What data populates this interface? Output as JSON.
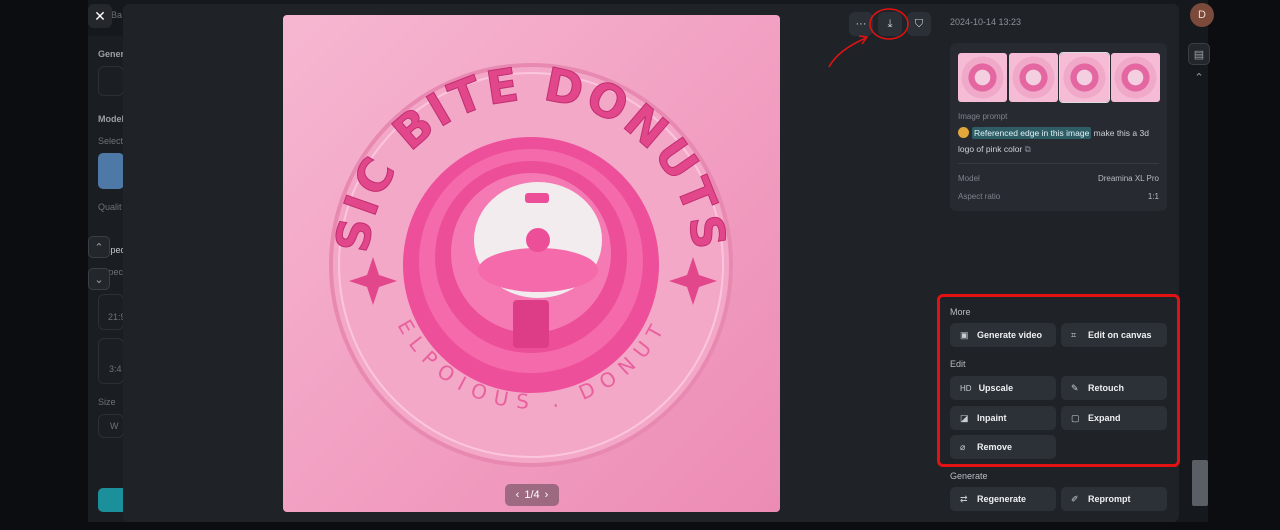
{
  "background": {
    "back_label": "Ba",
    "labels": [
      "Gener",
      "Model",
      "Select",
      "Qualit",
      "Aspec",
      "Aspec",
      "21:9",
      "3:4",
      "Size",
      "W"
    ],
    "avatar_letter": "D"
  },
  "toolbar": {
    "close_glyph": "✕",
    "more_glyph": "···",
    "download_glyph": "⤓",
    "bookmark_glyph": "⛉"
  },
  "image": {
    "top_text": "SIC BITE DONUTS",
    "bottom_text": "DELPOIOUS . DONUTS",
    "pager": "1/4",
    "prev_glyph": "‹",
    "next_glyph": "›"
  },
  "info": {
    "timestamp": "2024-10-14 13:23",
    "image_prompt_label": "Image prompt",
    "reference_chip": "Referenced edge in this image",
    "prompt_text": "make this a 3d logo of pink color",
    "copy_glyph": "⧉",
    "model_label": "Model",
    "model_value": "Dreamina XL Pro",
    "aspect_label": "Aspect ratio",
    "aspect_value": "1:1"
  },
  "actions": {
    "more_label": "More",
    "generate_video": "Generate video",
    "edit_on_canvas": "Edit on canvas",
    "edit_label": "Edit",
    "upscale": "Upscale",
    "retouch": "Retouch",
    "inpaint": "Inpaint",
    "expand": "Expand",
    "remove": "Remove",
    "generate_label": "Generate",
    "regenerate": "Regenerate",
    "reprompt": "Reprompt",
    "icons": {
      "generate_video": "▣",
      "edit_on_canvas": "⌗",
      "upscale": "HD",
      "retouch": "✎",
      "inpaint": "◪",
      "expand": "▢",
      "remove": "⌀",
      "regenerate": "⇄",
      "reprompt": "✐"
    }
  },
  "colors": {
    "annotation_red": "#e31212",
    "accent_pink": "#ec4f98",
    "reference_chip": "#2f5d66"
  }
}
